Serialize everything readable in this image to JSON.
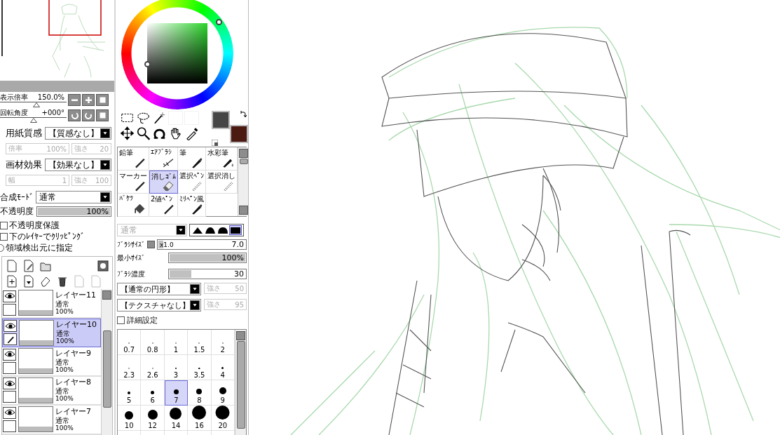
{
  "navigator": {
    "zoom": {
      "label": "表示倍率",
      "value": "150.0%",
      "level": 0.55
    },
    "rotation": {
      "label": "回転角度",
      "value": "+000°",
      "level": 0.5
    }
  },
  "paper_texture": {
    "label": "用紙質感",
    "value": "【質感なし】",
    "fields": [
      {
        "label": "倍率",
        "value": "100%",
        "disabled": true
      },
      {
        "label": "強さ",
        "value": "20",
        "disabled": true
      }
    ]
  },
  "material_effect": {
    "label": "画材効果",
    "value": "【効果なし】",
    "fields": [
      {
        "label": "幅",
        "value": "1",
        "disabled": true
      },
      {
        "label": "強さ",
        "value": "100",
        "disabled": true
      }
    ]
  },
  "blend_mode": {
    "label": "合成ﾓｰﾄﾞ",
    "value": "通常"
  },
  "opacity": {
    "label": "不透明度",
    "value": "100%",
    "level": 1
  },
  "options": [
    {
      "kind": "checkbox",
      "label": "不透明度保護",
      "checked": false
    },
    {
      "kind": "checkbox",
      "label": "下のﾚｲﾔｰでｸﾘｯﾋﾟﾝｸﾞ",
      "checked": false
    },
    {
      "kind": "radio",
      "label": "領域検出元に指定",
      "checked": false
    }
  ],
  "layers": [
    {
      "name": "レイヤー11",
      "mode": "通常",
      "opacity": "100%",
      "visible": true,
      "selected": false
    },
    {
      "name": "レイヤー10",
      "mode": "通常",
      "opacity": "100%",
      "visible": true,
      "selected": true
    },
    {
      "name": "レイヤー9",
      "mode": "通常",
      "opacity": "100%",
      "visible": true,
      "selected": false
    },
    {
      "name": "レイヤー8",
      "mode": "通常",
      "opacity": "100%",
      "visible": true,
      "selected": false
    },
    {
      "name": "レイヤー7",
      "mode": "通常",
      "opacity": "100%",
      "visible": true,
      "selected": false
    }
  ],
  "swatches": [
    {
      "color": "#464646"
    },
    {
      "color": "#4b1a10"
    }
  ],
  "tools": [
    {
      "label": "鉛筆",
      "kind": "pen",
      "selected": false
    },
    {
      "label": "ｴｱﾌﾞﾗｼ",
      "kind": "airbrush",
      "selected": false
    },
    {
      "label": "筆",
      "kind": "brush",
      "selected": false
    },
    {
      "label": "水彩筆",
      "kind": "watercolor",
      "selected": false
    },
    {
      "label": "マーカー",
      "kind": "pen",
      "selected": false
    },
    {
      "label": "消しｺﾞﾑ",
      "kind": "eraser",
      "selected": true
    },
    {
      "label": "選択ﾍﾟﾝ",
      "kind": "select",
      "selected": false
    },
    {
      "label": "選択消し",
      "kind": "select",
      "selected": false
    },
    {
      "label": "ﾊﾞｹﾂ",
      "kind": "bucket",
      "selected": false
    },
    {
      "label": "2値ﾍﾟﾝ",
      "kind": "pen",
      "selected": false
    },
    {
      "label": "ﾐﾘﾍﾟﾝ風",
      "kind": "brush",
      "selected": false
    }
  ],
  "brush": {
    "mode": "通常",
    "mode_disabled": true,
    "tip_shapes": [
      {
        "selected": false
      },
      {
        "selected": false
      },
      {
        "selected": false
      },
      {
        "selected": true
      }
    ],
    "size": {
      "label": "ﾌﾞﾗｼｻｲｽﾞ",
      "multiplier": "x1.0",
      "value": "7.0",
      "level": 0.07
    },
    "min_size": {
      "label": "最小ｻｲｽﾞ",
      "value": "100%",
      "level": 1
    },
    "density": {
      "label": "ﾌﾞﾗｼ濃度",
      "value": "30",
      "level": 0.3
    },
    "shape": {
      "value": "【通常の円形】",
      "strength_label": "強さ",
      "strength": "50",
      "strength_disabled": true
    },
    "texture": {
      "value": "【テクスチャなし】",
      "strength_label": "強さ",
      "strength": "95",
      "strength_disabled": true
    },
    "advanced": {
      "label": "詳細設定",
      "checked": false
    }
  },
  "sizes": [
    {
      "label": "0.7",
      "selected": false
    },
    {
      "label": "0.8",
      "selected": false
    },
    {
      "label": "1",
      "selected": false
    },
    {
      "label": "1.5",
      "selected": false
    },
    {
      "label": "2",
      "selected": false
    },
    {
      "label": "2.3",
      "selected": false
    },
    {
      "label": "2.6",
      "selected": false
    },
    {
      "label": "3",
      "selected": false
    },
    {
      "label": "3.5",
      "selected": false
    },
    {
      "label": "4",
      "selected": false
    },
    {
      "label": "5",
      "selected": false
    },
    {
      "label": "6",
      "selected": false
    },
    {
      "label": "7",
      "selected": true
    },
    {
      "label": "8",
      "selected": false
    },
    {
      "label": "9",
      "selected": false
    },
    {
      "label": "10",
      "selected": false
    },
    {
      "label": "12",
      "selected": false
    },
    {
      "label": "14",
      "selected": false
    },
    {
      "label": "16",
      "selected": false
    },
    {
      "label": "20",
      "selected": false
    }
  ]
}
